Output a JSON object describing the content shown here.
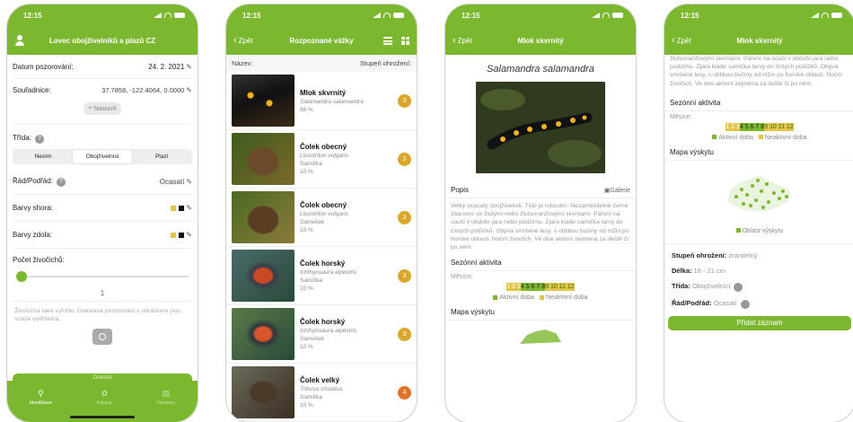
{
  "status": {
    "time": "12:15"
  },
  "screen1": {
    "title": "Lovec obojživelníků a plazů CZ",
    "date_label": "Datum pozorování:",
    "date_value": "24. 2. 2021",
    "coords_label": "Souřadnice:",
    "coords_value": "37.7858, -122.4064, 0.0000",
    "set_button": "Nastavit",
    "class_label": "Třída:",
    "class_options": [
      "Nevím",
      "Obojživelníci",
      "Plazi"
    ],
    "order_label": "Řád/Podřád:",
    "order_value": "Ocasatí",
    "colors_top_label": "Barvy shora:",
    "colors_bottom_label": "Barvy zdola:",
    "count_label": "Počet živočichů:",
    "count_value": "1",
    "count_slider_fraction": 0.0,
    "hint": "Živočicha také vyfoťte. Odeslaná pozorování s obrázkem jsou snáze ověřitelná.",
    "send_label": "Odeslat",
    "tabs": [
      "Identifikace",
      "Katalog",
      "Záznamy"
    ]
  },
  "screen2": {
    "back": "Zpět",
    "title": "Rozpoznané vážky",
    "col_name": "Název:",
    "col_threat": "Stupeň ohrožení:",
    "items": [
      {
        "name": "Mlok skvrnitý",
        "latin": "Salamandra salamandra",
        "sex": "",
        "pct": "88 %",
        "level": "3"
      },
      {
        "name": "Čolek obecný",
        "latin": "Lissotriton vulgaris",
        "sex": "Samička",
        "pct": "10 %",
        "level": "3"
      },
      {
        "name": "Čolek obecný",
        "latin": "Lissotriton vulgaris",
        "sex": "Sameček",
        "pct": "10 %",
        "level": "3"
      },
      {
        "name": "Čolek horský",
        "latin": "Ichthyosaura alpestris",
        "sex": "Samička",
        "pct": "10 %",
        "level": "3"
      },
      {
        "name": "Čolek horský",
        "latin": "Ichthyosaura alpestris",
        "sex": "Sameček",
        "pct": "10 %",
        "level": "3"
      },
      {
        "name": "Čolek velký",
        "latin": "Triturus cristatus",
        "sex": "Samička",
        "pct": "10 %",
        "level": "4"
      }
    ],
    "badge_colors": {
      "3": "#d9a72a",
      "4": "#e0732a"
    }
  },
  "screen3": {
    "back": "Zpět",
    "title": "Mlok skvrnitý",
    "latin": "Salamandra salamandra",
    "desc_title": "Popis",
    "gallery": "Galerie",
    "description": "Velký ocasatý obojživelník. Tělo je robustní. Nezaměnitelné černé zbarvení se žlutými nebo žlutooranžovými skvrnami. Páření na souši v období jara nebo podzimu. Zjara klade samička larvy do čistých potůčků. Obývá smíšené lesy, s oblibou bučiny od nížin po horské oblasti. Noční živočich. Ve dne aktivní zejména za deště či po něm.",
    "season_title": "Sezónní aktivita",
    "months_label": "Měsíce:",
    "active_legend": "Aktivní doba",
    "inactive_legend": "Neaktivní doba",
    "map_title": "Mapa výskytu"
  },
  "screen4": {
    "back": "Zpět",
    "title": "Mlok skvrnitý",
    "description_tail": "žlutooranžovými skvrnami. Páření na souši v období jara nebo podzimu. Zjara klade samička larvy do čistých potůčků. Obývá smíšené lesy, s oblibou bučiny od nížin po horské oblasti. Noční živočich. Ve dne aktivní zejména za deště či po něm.",
    "season_title": "Sezónní aktivita",
    "months_label": "Měsíce:",
    "active_legend": "Aktivní doba",
    "inactive_legend": "Neaktivní doba",
    "map_title": "Mapa výskytu",
    "map_legend": "Oblast výskytu",
    "threat_label": "Stupeň ohrožení:",
    "threat_value": "zranitelný",
    "length_label": "Délka:",
    "length_value": "16 - 21 cm",
    "class_label": "Třída:",
    "class_value": "Obojživelníci",
    "order_label": "Řád/Podřád:",
    "order_value": "Ocasatí",
    "add_button": "Přidat záznam"
  },
  "months": {
    "inactive_before": "1 2 3",
    "active": "4 5 6 7 8",
    "inactive_after": "9 10 11 12"
  },
  "colors": {
    "brand": "#7cb82f",
    "inactive": "#e5c44a"
  }
}
